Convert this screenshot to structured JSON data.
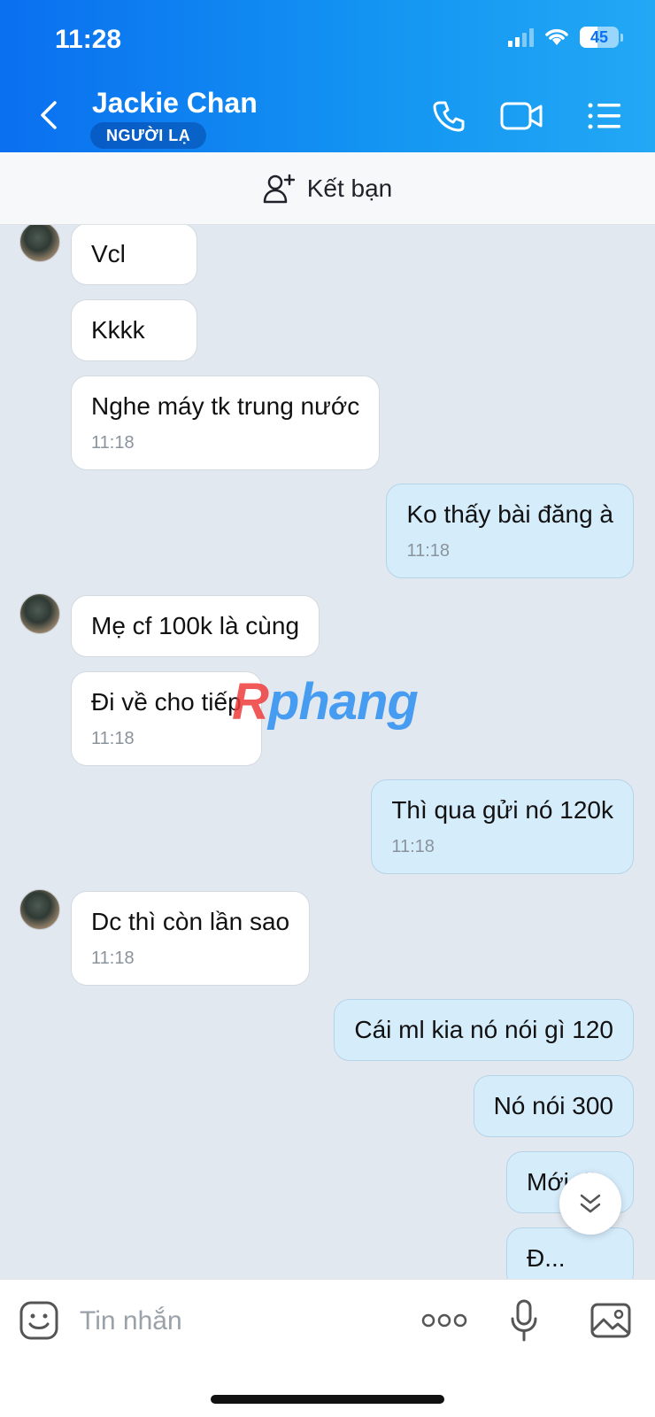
{
  "status_bar": {
    "time": "11:28",
    "battery": "45"
  },
  "header": {
    "title": "Jackie Chan",
    "badge": "NGƯỜI LẠ",
    "icons": [
      "back-icon",
      "phone-icon",
      "video-call-icon",
      "menu-icon"
    ]
  },
  "add_friend": {
    "label": "Kết bạn",
    "icon": "add-user-icon"
  },
  "messages": [
    {
      "side": "in",
      "text": "Vcl"
    },
    {
      "side": "in",
      "text": "Kkkk"
    },
    {
      "side": "in",
      "text": "Nghe máy tk trung nước",
      "time": "11:18"
    },
    {
      "side": "out",
      "text": "Ko thấy bài đăng à",
      "time": "11:18"
    },
    {
      "side": "in",
      "text": "Mẹ cf 100k là cùng"
    },
    {
      "side": "in",
      "text": "Đi về cho tiếp",
      "time": "11:18"
    },
    {
      "side": "out",
      "text": "Thì qua gửi nó 120k",
      "time": "11:18"
    },
    {
      "side": "in",
      "text": "Dc thì còn lần sao",
      "time": "11:18"
    },
    {
      "side": "out",
      "text": "Cái ml kia nó nói gì 120"
    },
    {
      "side": "out",
      "text": "Nó nói 300"
    },
    {
      "side": "out",
      "text": "Mới đi"
    },
    {
      "side": "out",
      "text": "Đ..."
    }
  ],
  "watermark": {
    "first": "R",
    "rest": "phang"
  },
  "input": {
    "placeholder": "Tin nhắn"
  },
  "colors": {
    "header": "#0a6ff0",
    "out_bubble": "#d5ecfb",
    "in_bubble": "#ffffff",
    "chat_bg": "#e2e8f0"
  }
}
